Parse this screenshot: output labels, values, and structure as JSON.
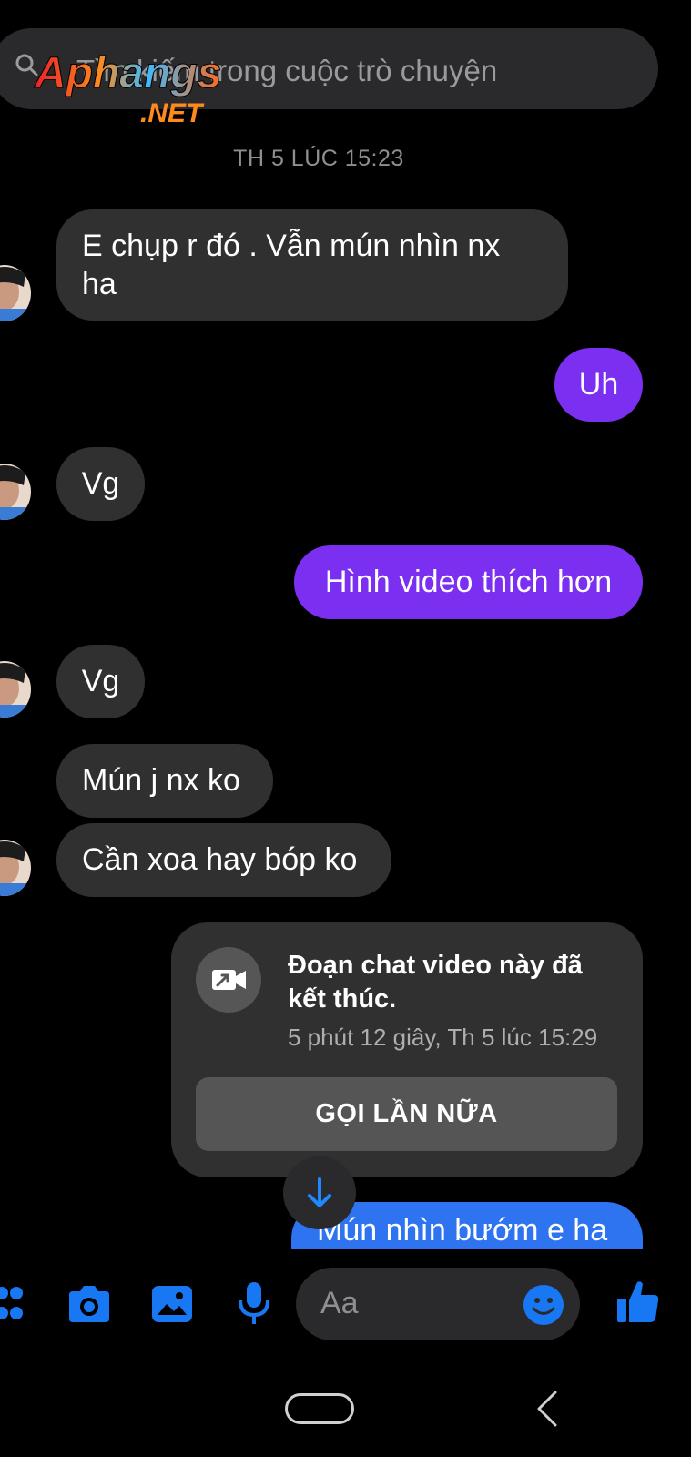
{
  "search": {
    "placeholder": "Tìm kiếm trong cuộc trò chuyện"
  },
  "watermark": {
    "brand": "Aphangs",
    "suffix": ".NET"
  },
  "timestamp": "TH 5 LÚC 15:23",
  "messages": [
    {
      "from": "them",
      "text": "E chụp r đó . Vẫn mún nhìn nx ha"
    },
    {
      "from": "me",
      "text": "Uh"
    },
    {
      "from": "them",
      "text": "Vg"
    },
    {
      "from": "me",
      "text": "Hình video thích hơn"
    },
    {
      "from": "them",
      "text": "Vg"
    },
    {
      "from": "them",
      "text": "Mún j nx ko"
    },
    {
      "from": "them",
      "text": "Cần xoa hay bóp ko"
    },
    {
      "from": "me",
      "text": "Mún nhìn bướm e ha"
    }
  ],
  "call_card": {
    "title": "Đoạn chat video này đã kết thúc.",
    "subtitle": "5 phút 12 giây, Th 5 lúc 15:29",
    "button_label": "GỌI LẦN NỮA"
  },
  "composer": {
    "placeholder": "Aa"
  },
  "colors": {
    "accent": "#1877f2",
    "outgoing_purple": "#7b2ff0",
    "outgoing_blue": "#2e74f0",
    "incoming": "#303030"
  },
  "icons": [
    "search-icon",
    "menu-dots-icon",
    "camera-icon",
    "gallery-icon",
    "microphone-icon",
    "emoji-icon",
    "like-icon",
    "video-call-icon",
    "arrow-down-icon",
    "back-icon"
  ]
}
